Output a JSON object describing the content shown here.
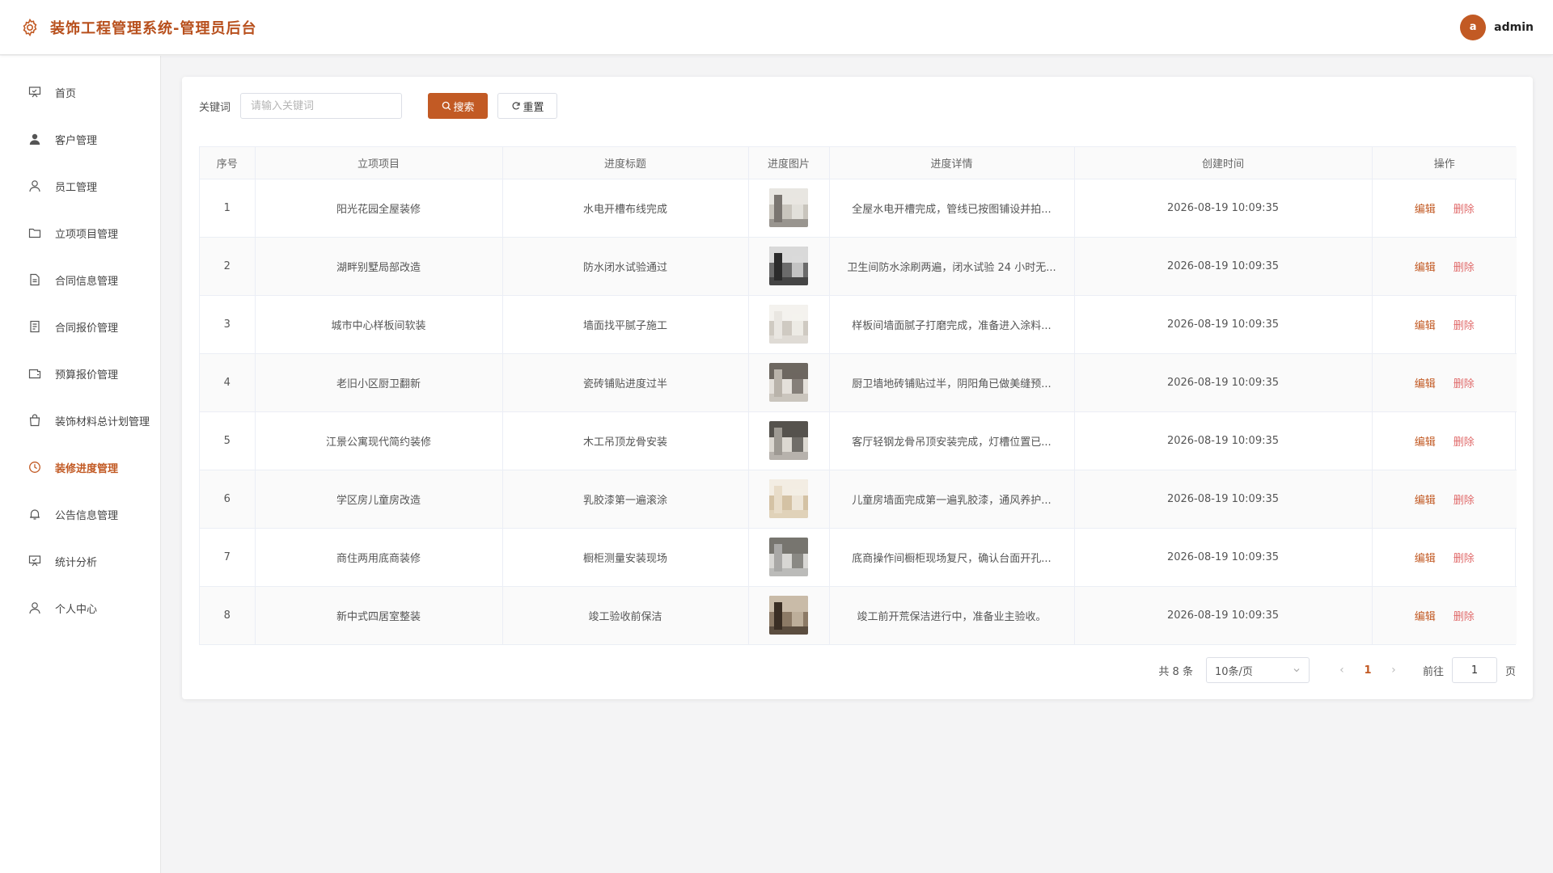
{
  "header": {
    "title": "装饰工程管理系统-管理员后台",
    "avatar_letter": "a",
    "user_name": "admin",
    "accent": "#c25a24"
  },
  "sidebar": {
    "items": [
      {
        "label": "首页",
        "icon": "presentation-icon"
      },
      {
        "label": "客户管理",
        "icon": "user-filled-icon"
      },
      {
        "label": "员工管理",
        "icon": "user-icon"
      },
      {
        "label": "立项项目管理",
        "icon": "folder-icon"
      },
      {
        "label": "合同信息管理",
        "icon": "document-icon"
      },
      {
        "label": "合同报价管理",
        "icon": "tickets-icon"
      },
      {
        "label": "预算报价管理",
        "icon": "wallet-icon"
      },
      {
        "label": "装饰材料总计划管理",
        "icon": "shopping-bag-icon"
      },
      {
        "label": "装修进度管理",
        "icon": "clock-icon",
        "active": true
      },
      {
        "label": "公告信息管理",
        "icon": "bell-icon"
      },
      {
        "label": "统计分析",
        "icon": "presentation-icon"
      },
      {
        "label": "个人中心",
        "icon": "user-icon"
      }
    ]
  },
  "search": {
    "label": "关键词",
    "placeholder": "请输入关键词",
    "value": "",
    "search_button": "搜索",
    "reset_button": "重置"
  },
  "table": {
    "columns": [
      "序号",
      "立项项目",
      "进度标题",
      "进度图片",
      "进度详情",
      "创建时间",
      "操作"
    ],
    "edit_label": "编辑",
    "delete_label": "删除",
    "rows": [
      {
        "index": "1",
        "project": "阳光花园全屋装修",
        "title": "水电开槽布线完成",
        "detail": "全屋水电开槽完成，管线已按图铺设并拍...",
        "created": "2026-08-19 10:09:35",
        "thumb": [
          "#7a7570",
          "#c9c5bd",
          "#e8e6e1"
        ]
      },
      {
        "index": "2",
        "project": "湖畔别墅局部改造",
        "title": "防水闭水试验通过",
        "detail": "卫生间防水涂刷两遍，闭水试验 24 小时无...",
        "created": "2026-08-19 10:09:35",
        "thumb": [
          "#2b2b2b",
          "#6b6b6b",
          "#d9d9d9"
        ]
      },
      {
        "index": "3",
        "project": "城市中心样板间软装",
        "title": "墙面找平腻子施工",
        "detail": "样板间墙面腻子打磨完成，准备进入涂料...",
        "created": "2026-08-19 10:09:35",
        "thumb": [
          "#e9e6e1",
          "#cfcac2",
          "#f4f2ee"
        ]
      },
      {
        "index": "4",
        "project": "老旧小区厨卫翻新",
        "title": "瓷砖铺贴进度过半",
        "detail": "厨卫墙地砖铺贴过半，阴阳角已做美缝预...",
        "created": "2026-08-19 10:09:35",
        "thumb": [
          "#b9b3aa",
          "#e4e0da",
          "#6d6760"
        ]
      },
      {
        "index": "5",
        "project": "江景公寓现代简约装修",
        "title": "木工吊顶龙骨安装",
        "detail": "客厅轻钢龙骨吊顶安装完成，灯槽位置已...",
        "created": "2026-08-19 10:09:35",
        "thumb": [
          "#9e9a93",
          "#dcd8d1",
          "#55524d"
        ]
      },
      {
        "index": "6",
        "project": "学区房儿童房改造",
        "title": "乳胶漆第一遍滚涂",
        "detail": "儿童房墙面完成第一遍乳胶漆，通风养护...",
        "created": "2026-08-19 10:09:35",
        "thumb": [
          "#e8dcc8",
          "#d4c2a4",
          "#f3ede3"
        ]
      },
      {
        "index": "7",
        "project": "商住两用底商装修",
        "title": "橱柜测量安装现场",
        "detail": "底商操作间橱柜现场复尺，确认台面开孔...",
        "created": "2026-08-19 10:09:35",
        "thumb": [
          "#a9a8a6",
          "#d8d7d4",
          "#77756f"
        ]
      },
      {
        "index": "8",
        "project": "新中式四居室整装",
        "title": "竣工验收前保洁",
        "detail": "竣工前开荒保洁进行中，准备业主验收。",
        "created": "2026-08-19 10:09:35",
        "thumb": [
          "#3a2e24",
          "#8c7a66",
          "#c9bba8"
        ]
      }
    ]
  },
  "pagination": {
    "total_text": "共 8 条",
    "page_size": "10条/页",
    "current_page": "1",
    "goto_label": "前往",
    "goto_value": "1",
    "goto_unit": "页"
  }
}
